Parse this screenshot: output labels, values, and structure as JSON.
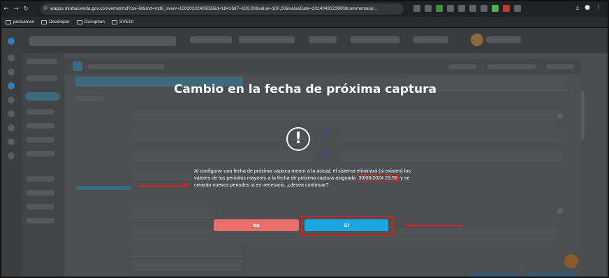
{
  "browser": {
    "url": "wapps.minhacienda.gov.co/sve/md/md?cw=M&md=md6_sve/v=1002020240502&id=18416d7=100,00&value=100,00&valueDate=20240430239008commentaryl...",
    "bookmarks": [
      "pensamos",
      "Developer",
      "Disruption",
      "SVE10"
    ]
  },
  "modal": {
    "title": "Cambio en la fecha de próxima captura",
    "message_part1": "Al configurar una fecha de próxima captura menor a la actual, el sistema eliminará (si existen) los valores de los periodos mayores a la fecha de próxima captura asignada ",
    "date": "30/06/2024 23:59",
    "message_part2": " y se crearán nuevos periodos si es necesario, ¿desea continuar?",
    "no_label": "No",
    "yes_label": "Sí",
    "warning_icon": "!"
  },
  "colors": {
    "no_button": "#e96f6c",
    "yes_button": "#1aa6de",
    "annotation_red": "#e01e1e"
  }
}
